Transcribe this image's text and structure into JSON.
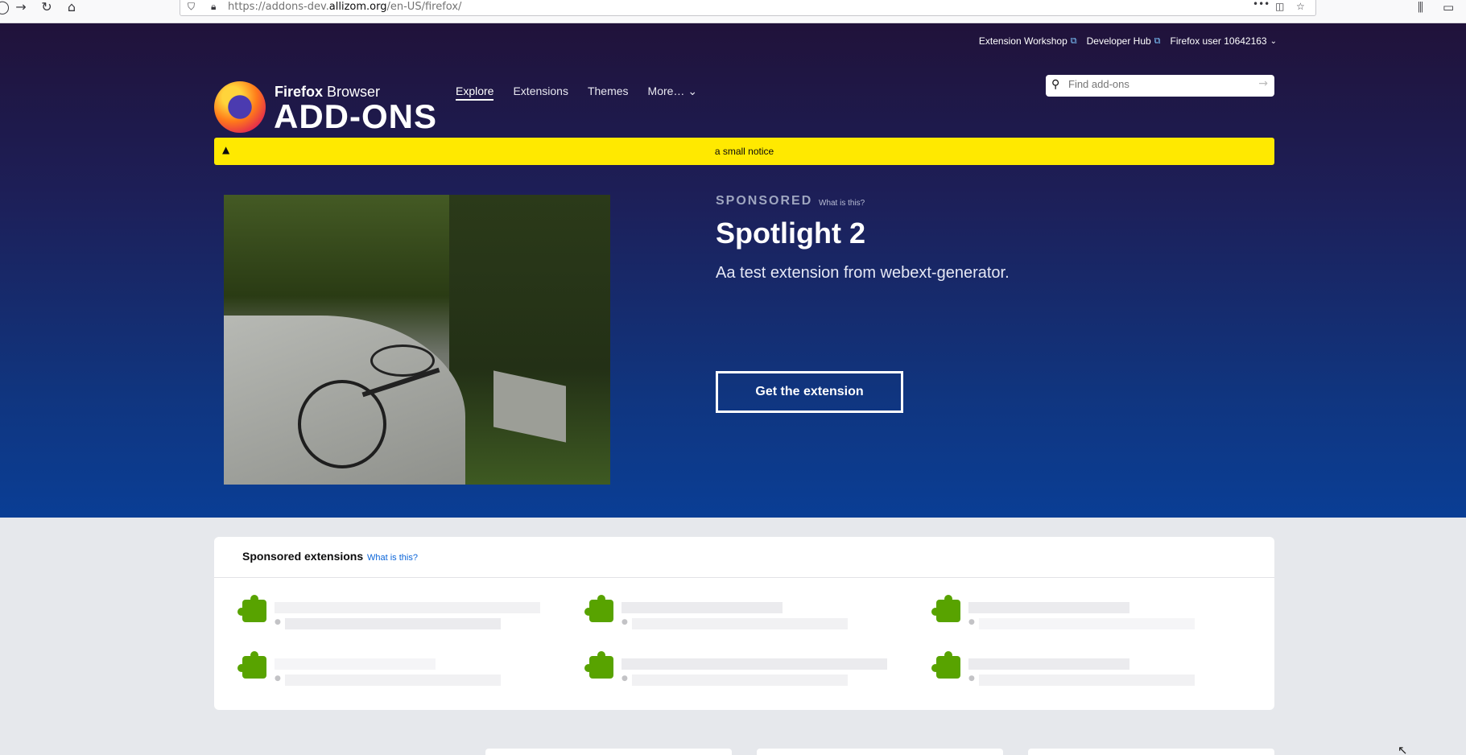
{
  "browser": {
    "url_prefix": "https://addons-dev.",
    "url_domain": "allizom.org",
    "url_suffix": "/en-US/firefox/",
    "more_icon": "•••"
  },
  "header": {
    "links": [
      {
        "label": "Extension Workshop"
      },
      {
        "label": "Developer Hub"
      },
      {
        "label": "Firefox user 10642163"
      }
    ],
    "brand_small_bold": "Firefox",
    "brand_small_rest": " Browser",
    "brand_big": "ADD-ONS",
    "nav": [
      {
        "label": "Explore"
      },
      {
        "label": "Extensions"
      },
      {
        "label": "Themes"
      },
      {
        "label": "More…"
      }
    ],
    "search_placeholder": "Find add-ons"
  },
  "notice": {
    "text": "a small notice"
  },
  "spotlight": {
    "sponsored_label": "SPONSORED",
    "what_is_this": "What is this?",
    "title": "Spotlight 2",
    "description": "Aa test extension from webext-generator.",
    "button_label": "Get the extension"
  },
  "sponsored_card": {
    "title": "Sponsored extensions",
    "what_is_this": "What is this?"
  }
}
